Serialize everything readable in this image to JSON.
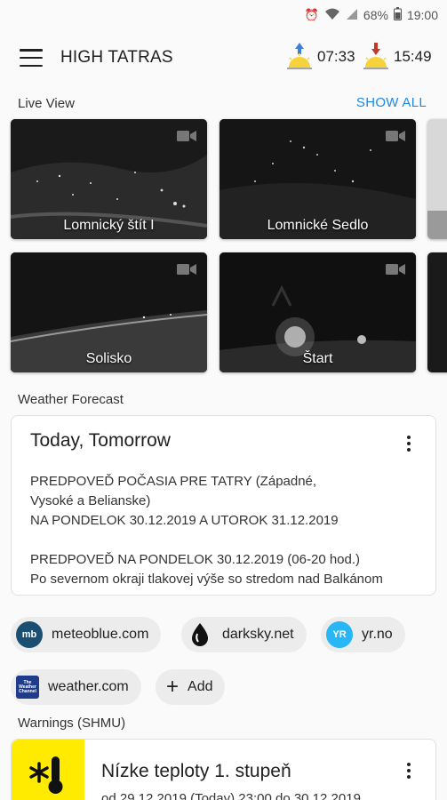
{
  "status_bar": {
    "battery": "68%",
    "time": "19:00"
  },
  "app_bar": {
    "title": "HIGH TATRAS",
    "sunrise": "07:33",
    "sunset": "15:49"
  },
  "live_view": {
    "label": "Live View",
    "show_all": "SHOW ALL",
    "cameras": [
      {
        "name": "Lomnický štít I"
      },
      {
        "name": "Lomnické Sedlo"
      },
      {
        "name": "Solisko"
      },
      {
        "name": "Štart"
      }
    ]
  },
  "forecast": {
    "label": "Weather Forecast",
    "title": "Today, Tomorrow",
    "lines": [
      "PREDPOVEĎ POČASIA PRE TATRY (Západné,",
      "Vysoké a Belianske)",
      "NA PONDELOK 30.12.2019 A UTOROK 31.12.2019",
      "",
      "PREDPOVEĎ NA PONDELOK 30.12.2019 (06-20 hod.)",
      "Po severnom okraji tlakovej výše so stredom nad Balkánom"
    ]
  },
  "sources": {
    "meteoblue": "meteoblue.com",
    "darksky": "darksky.net",
    "yr": "yr.no",
    "weather": "weather.com",
    "add": "Add",
    "meteoblue_logo": "mb",
    "yr_logo": "YR",
    "weather_logo": "The Weather Channel"
  },
  "warnings": {
    "label": "Warnings (SHMU)",
    "title": "Nízke teploty  1. stupeň",
    "period": "od 29.12.2019 (Today) 23:00 do 30.12.2019"
  },
  "colors": {
    "accent": "#1e88e5",
    "warning_yellow": "#ffeb00"
  }
}
